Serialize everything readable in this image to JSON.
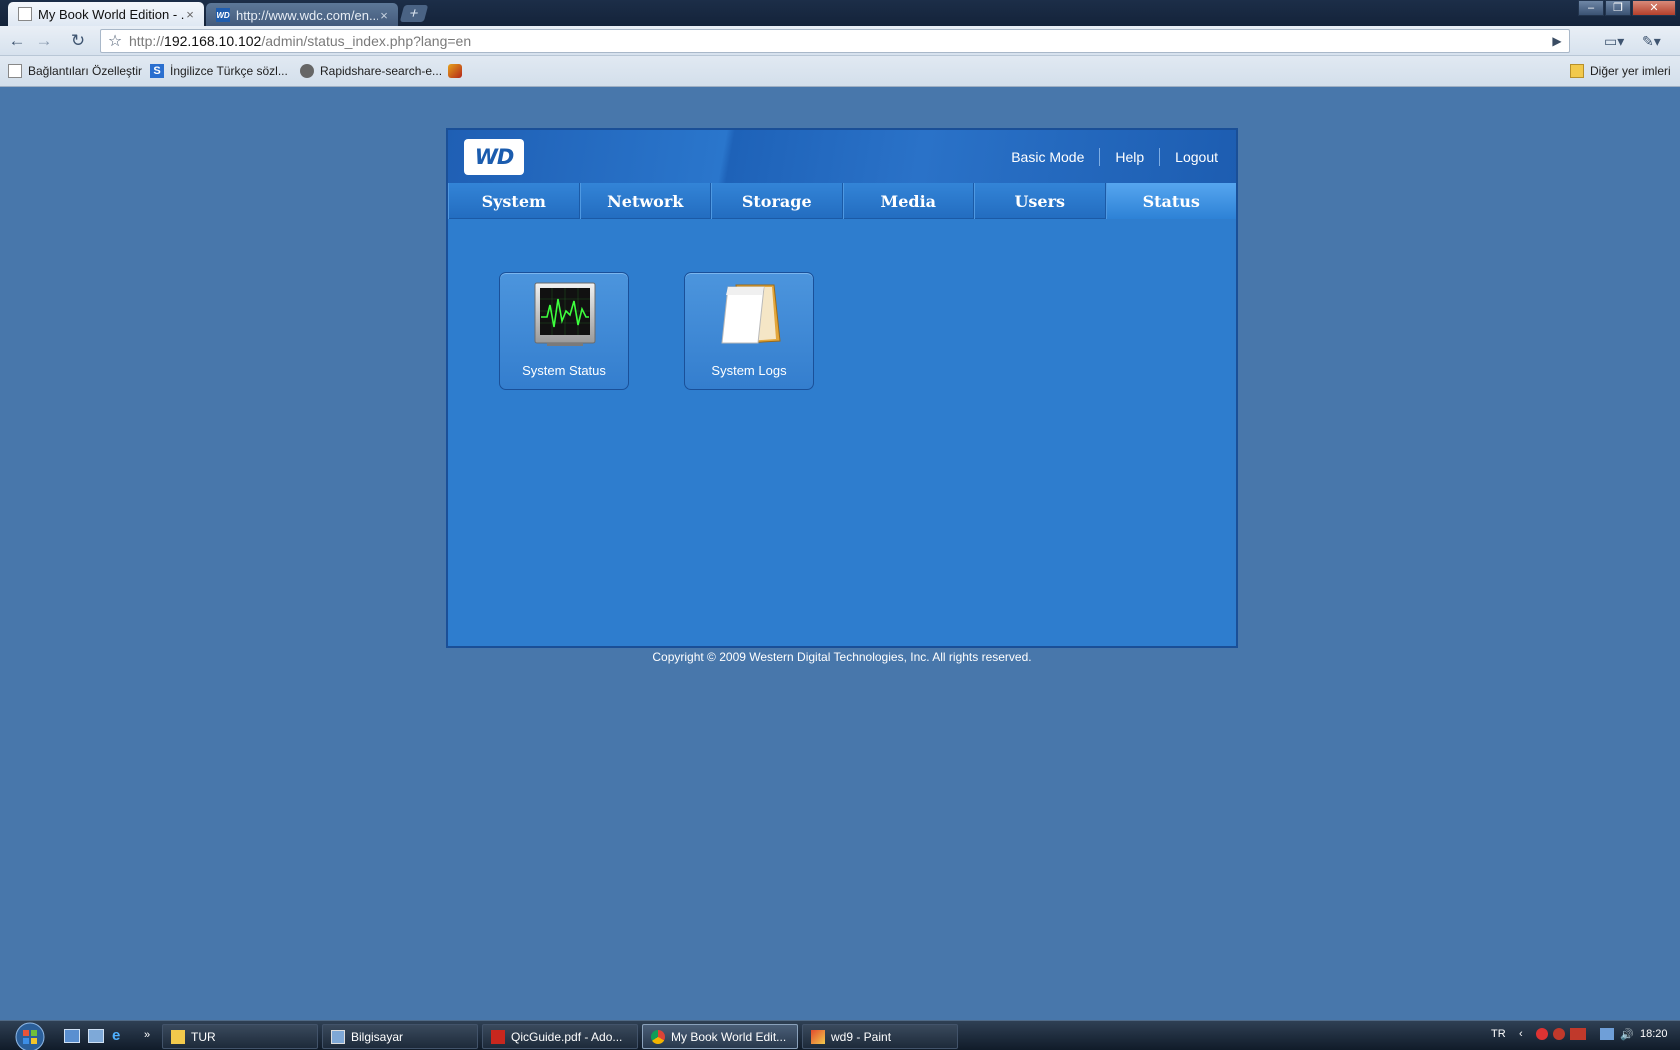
{
  "browser": {
    "tabs": [
      {
        "title": "My Book World Edition - ...",
        "active": true
      },
      {
        "title": "http://www.wdc.com/en...",
        "active": false
      }
    ],
    "new_tab_glyph": "+",
    "address": {
      "prefix": "http://",
      "host": "192.168.10.102",
      "path": "/admin/status_index.php?lang=en"
    },
    "bookmarks": [
      {
        "label": "Bağlantıları Özelleştir",
        "icon": "page-icon"
      },
      {
        "label": "İngilizce Türkçe sözl...",
        "icon": "s-icon"
      },
      {
        "label": "Rapidshare-search-e...",
        "icon": "gear-icon"
      },
      {
        "label": "",
        "icon": "extension-icon"
      }
    ],
    "other_bookmarks": "Diğer yer imleri"
  },
  "wd": {
    "logo_text": "WD",
    "top_links": {
      "basic_mode": "Basic Mode",
      "help": "Help",
      "logout": "Logout"
    },
    "nav": [
      "System",
      "Network",
      "Storage",
      "Media",
      "Users",
      "Status"
    ],
    "active_nav": "Status",
    "tiles": [
      {
        "label": "System Status",
        "icon": "monitor-activity-icon"
      },
      {
        "label": "System Logs",
        "icon": "notepad-icon"
      }
    ],
    "copyright": "Copyright © 2009 Western Digital Technologies, Inc. All rights reserved."
  },
  "taskbar": {
    "tasks": [
      {
        "label": "TUR",
        "icon": "folder-icon"
      },
      {
        "label": "Bilgisayar",
        "icon": "computer-icon"
      },
      {
        "label": "QicGuide.pdf - Ado...",
        "icon": "pdf-icon"
      },
      {
        "label": "My Book World Edit...",
        "icon": "chrome-icon",
        "active": true
      },
      {
        "label": "wd9 - Paint",
        "icon": "paint-icon"
      }
    ],
    "language": "TR",
    "clock": "18:20"
  },
  "colors": {
    "page_bg": "#4877ab",
    "panel_bg": "#2e7dce",
    "active_tab": "#56a6ef"
  }
}
